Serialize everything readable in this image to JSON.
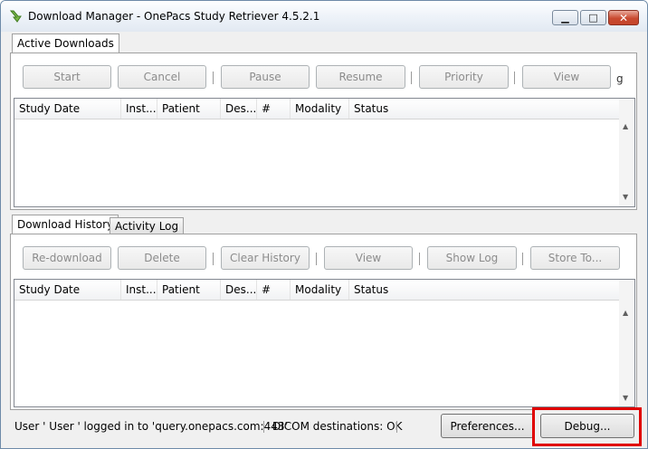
{
  "window": {
    "title": "Download Manager - OnePacs Study Retriever 4.5.2.1"
  },
  "active": {
    "tab": "Active Downloads",
    "toolbar": [
      "Start",
      "Cancel",
      "Pause",
      "Resume",
      "Priority",
      "View"
    ],
    "toolbar_trailing": "g",
    "columns": [
      "Study Date",
      "Inst...",
      "Patient",
      "Des...",
      "#",
      "Modality",
      "Status"
    ]
  },
  "history": {
    "tabs": [
      "Download History",
      "Activity Log"
    ],
    "toolbar": [
      "Re-download",
      "Delete",
      "Clear History",
      "View",
      "Show Log",
      "Store To..."
    ],
    "columns": [
      "Study Date",
      "Inst...",
      "Patient",
      "Des...",
      "#",
      "Modality",
      "Status"
    ]
  },
  "status": {
    "login": "User ' User    ' logged in to 'query.onepacs.com:443'",
    "dicom": "DICOM destinations: OK",
    "preferences_label": "Preferences...",
    "debug_label": "Debug..."
  },
  "colors": {
    "highlight": "#e00000",
    "disabled_text": "#8c8c8c"
  },
  "icons": {
    "app": "download-arrow-icon",
    "minimize": "minimize-icon",
    "maximize": "maximize-icon",
    "close": "close-icon"
  }
}
